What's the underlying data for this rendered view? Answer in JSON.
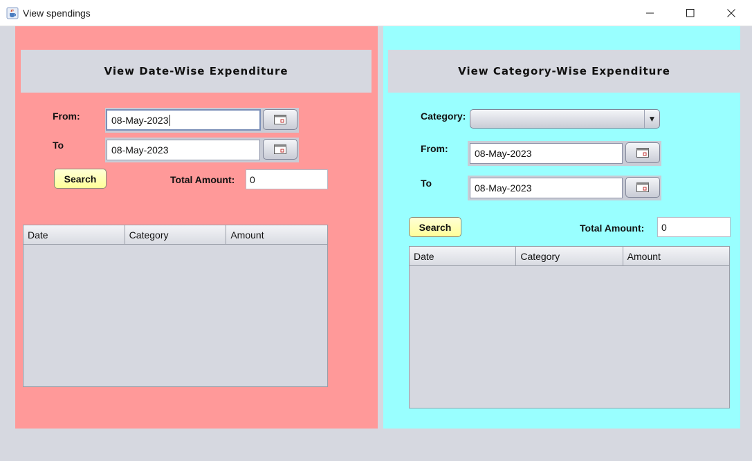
{
  "window": {
    "title": "View spendings",
    "icon": "java-cup-icon",
    "controls": [
      "minimize-icon",
      "maximize-icon",
      "close-icon"
    ]
  },
  "colors": {
    "left_panel": "#ff9999",
    "right_panel": "#99ffff",
    "header_bg": "#d6d8e0",
    "search_button": "#ffff99"
  },
  "date_wise": {
    "title": "View Date-Wise Expenditure",
    "from_label": "From:",
    "from_value": "08-May-2023",
    "to_label": "To",
    "to_value": "08-May-2023",
    "search_label": "Search",
    "total_label": "Total Amount:",
    "total_value": "0",
    "table": {
      "columns": [
        "Date",
        "Category",
        "Amount"
      ],
      "rows": []
    }
  },
  "category_wise": {
    "title": "View Category-Wise Expenditure",
    "category_label": "Category:",
    "category_value": "",
    "from_label": "From:",
    "from_value": "08-May-2023",
    "to_label": "To",
    "to_value": "08-May-2023",
    "search_label": "Search",
    "total_label": "Total Amount:",
    "total_value": "0",
    "table": {
      "columns": [
        "Date",
        "Category",
        "Amount"
      ],
      "rows": []
    }
  }
}
